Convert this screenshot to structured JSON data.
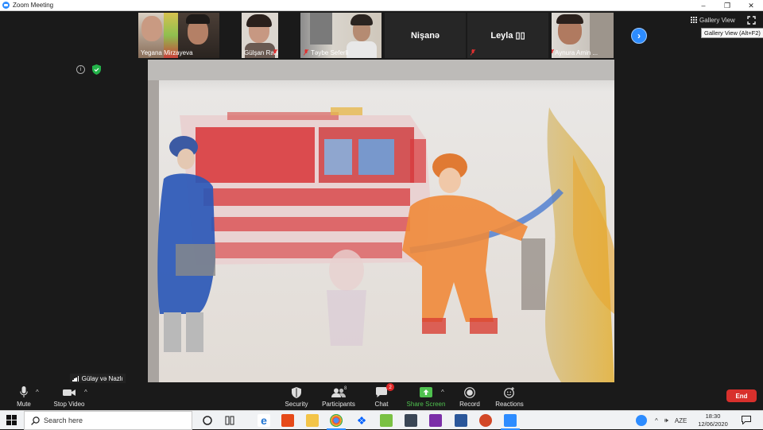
{
  "window": {
    "title": "Zoom Meeting",
    "controls": [
      "–",
      "❐",
      "✕"
    ]
  },
  "participants": [
    {
      "name": "Yegana Mirzayeva",
      "video": true,
      "muted": false
    },
    {
      "name": "Gülşan Rahimli",
      "video": true,
      "muted": false
    },
    {
      "name": "Təybe Seferli",
      "video": true,
      "muted": true
    },
    {
      "name": "Nişanə",
      "video": false,
      "muted": true
    },
    {
      "name": "Leyla ▯▯",
      "video": false,
      "muted": true
    },
    {
      "name": "Aynura Amin ...",
      "video": true,
      "muted": true
    }
  ],
  "view": {
    "gallery_label": "Gallery View",
    "gallery_tooltip": "Gallery View (Alt+F2)"
  },
  "active_speaker": "Gülay və Nazlı",
  "toolbar": {
    "mute": "Mute",
    "stop_video": "Stop Video",
    "security": "Security",
    "participants": "Participants",
    "participants_count": "8",
    "chat": "Chat",
    "chat_badge": "2",
    "share_screen": "Share Screen",
    "record": "Record",
    "reactions": "Reactions",
    "end": "End"
  },
  "taskbar": {
    "search_placeholder": "Search here",
    "language": "AZE",
    "time": "18:30",
    "date": "12/06/2020"
  },
  "colors": {
    "zoom_blue": "#2d8cff",
    "end_red": "#d8302c",
    "share_green": "#4fc14f",
    "background": "#1a1a1a"
  }
}
